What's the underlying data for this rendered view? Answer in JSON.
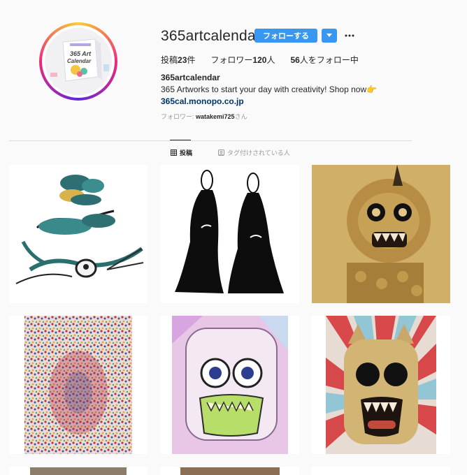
{
  "profile": {
    "username": "365artcalendar",
    "follow_label": "フォローする",
    "posts_prefix": "投稿",
    "posts_count": "23",
    "posts_suffix": "件",
    "followers_prefix": "フォロワー",
    "followers_count": "120",
    "followers_suffix": "人",
    "following_count": "56",
    "following_suffix": "人をフォロー中",
    "bio_name": "365artcalendar",
    "bio_text": "365 Artworks to start your day with creativity! Shop now👉",
    "bio_link": "365cal.monopo.co.jp",
    "followed_by_prefix": "フォロワー: ",
    "followed_by_user": "watakemi725",
    "followed_by_suffix": "さん",
    "avatar_text_line1": "365 Art",
    "avatar_text_line2": "Calendar"
  },
  "tabs": [
    {
      "label": "投稿",
      "icon": "grid-icon",
      "active": true
    },
    {
      "label": "タグ付けされている人",
      "icon": "tag-user-icon",
      "active": false
    }
  ],
  "colors": {
    "accent": "#3897f0",
    "link": "#003569",
    "muted": "#999999",
    "text": "#262626",
    "background": "#fafafa"
  },
  "posts": [
    {
      "subject": "teal-bird-ink-art"
    },
    {
      "subject": "two-black-robed-figures"
    },
    {
      "subject": "gold-lion-mask"
    },
    {
      "subject": "colorful-dot-pattern"
    },
    {
      "subject": "pastel-monster-face"
    },
    {
      "subject": "cat-rising-sun"
    }
  ]
}
